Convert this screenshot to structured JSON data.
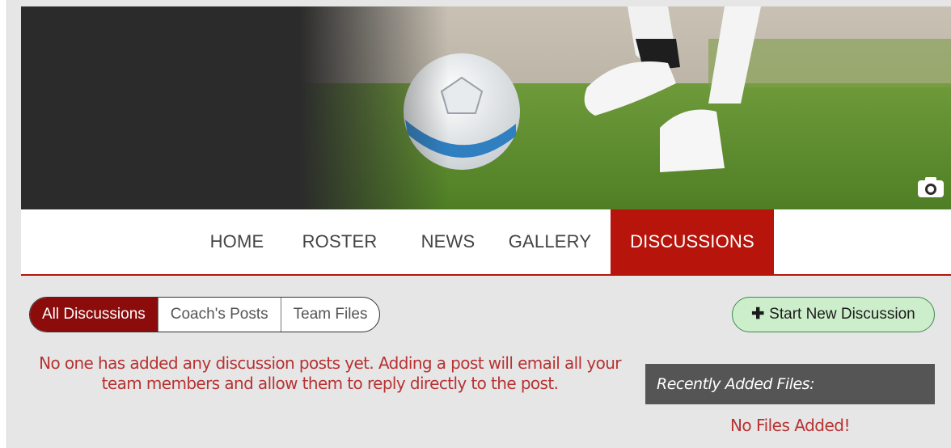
{
  "nav": {
    "items": [
      {
        "label": "HOME",
        "active": false
      },
      {
        "label": "ROSTER",
        "active": false
      },
      {
        "label": "NEWS",
        "active": false
      },
      {
        "label": "GALLERY",
        "active": false
      },
      {
        "label": "DISCUSSIONS",
        "active": true
      }
    ]
  },
  "hero": {
    "camera_icon": "camera-icon"
  },
  "tabs": [
    {
      "label": "All Discussions",
      "active": true
    },
    {
      "label": "Coach's Posts",
      "active": false
    },
    {
      "label": "Team Files",
      "active": false
    }
  ],
  "start_button": {
    "icon": "plus-icon",
    "label": "Start New Discussion"
  },
  "empty_message": {
    "line1": "No one has added any discussion posts yet. Adding a post will email all your",
    "line2": "team members and allow them to reply directly to the post."
  },
  "files": {
    "header": "Recently Added Files:",
    "empty": "No Files Added!"
  },
  "colors": {
    "accent": "#b7140b",
    "active_tab": "#8c0b0b",
    "start_button_bg": "#cdeecb",
    "message_text": "#b83232",
    "files_header_bg": "#555555"
  }
}
